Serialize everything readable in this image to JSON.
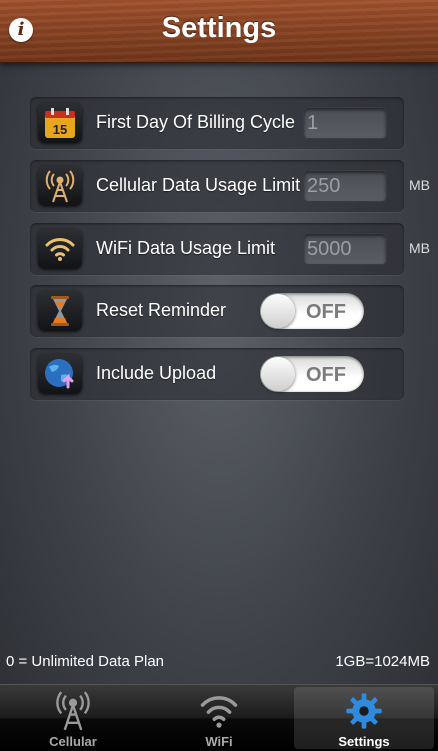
{
  "header": {
    "title": "Settings",
    "info_label": "i"
  },
  "rows": [
    {
      "label": "First Day Of Billing Cycle",
      "value": "1",
      "unit": "",
      "icon": "calendar-icon",
      "icon_text": "15"
    },
    {
      "label": "Cellular Data Usage Limit",
      "value": "250",
      "unit": "MB",
      "icon": "cell-tower-icon"
    },
    {
      "label": "WiFi Data Usage Limit",
      "value": "5000",
      "unit": "MB",
      "icon": "wifi-icon"
    },
    {
      "label": "Reset Reminder",
      "toggle": "OFF",
      "icon": "hourglass-icon"
    },
    {
      "label": "Include Upload",
      "toggle": "OFF",
      "icon": "globe-upload-icon"
    }
  ],
  "notes": {
    "left": "0 = Unlimited Data Plan",
    "right": "1GB=1024MB"
  },
  "tabs": [
    {
      "label": "Cellular",
      "icon": "cell-tower-icon",
      "active": false
    },
    {
      "label": "WiFi",
      "icon": "wifi-icon",
      "active": false
    },
    {
      "label": "Settings",
      "icon": "gear-icon",
      "active": true
    }
  ],
  "colors": {
    "header_wood": "#8a4424",
    "active_tab_icon": "#2f8be0"
  }
}
